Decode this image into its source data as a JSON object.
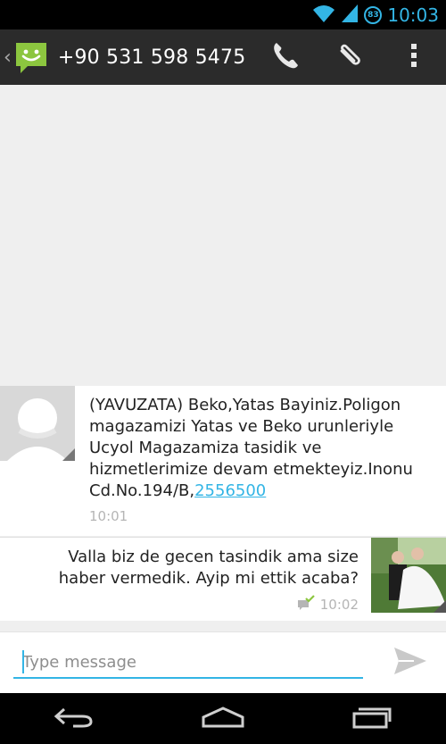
{
  "status_bar": {
    "time": "10:03",
    "battery_level": "83",
    "icons": [
      "wifi-icon",
      "signal-icon",
      "battery-icon"
    ]
  },
  "action_bar": {
    "title": "+90 531 598 5475",
    "app_icon": "messaging-app-icon",
    "actions": [
      "phone-icon",
      "attach-icon",
      "overflow-menu-icon"
    ]
  },
  "messages": [
    {
      "direction": "incoming",
      "text_before_link": "(YAVUZATA) Beko,Yatas Bayiniz.Poligon magazamizi Yatas ve Beko urunleriyle Ucyol Magazamiza tasidik ve hizmetlerimize devam etmekteyiz.Inonu Cd.No.194/B,",
      "link": "2556500",
      "time": "10:01"
    },
    {
      "direction": "outgoing",
      "text": "Valla biz de gecen tasindik ama size haber vermedik. Ayip mi ettik acaba?",
      "time": "10:02",
      "status_icon": "delivered-check-icon"
    }
  ],
  "composer": {
    "placeholder": "Type message",
    "value": ""
  },
  "nav_bar": {
    "buttons": [
      "back-icon",
      "home-icon",
      "recents-icon"
    ]
  },
  "colors": {
    "accent": "#33b5e5",
    "action_bar": "#2b2b2b",
    "app_icon_green": "#8cc63f"
  }
}
